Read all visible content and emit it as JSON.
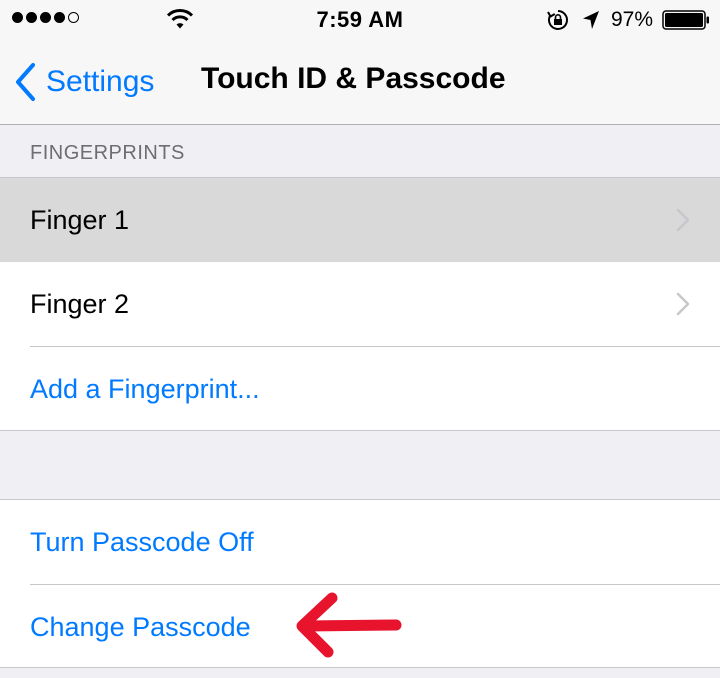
{
  "status_bar": {
    "time": "7:59 AM",
    "battery_percent": "97%",
    "signal_bars_filled": 4,
    "signal_bars_total": 5,
    "icons": [
      "wifi-icon",
      "rotation-lock-icon",
      "location-arrow-icon",
      "battery-icon"
    ]
  },
  "nav": {
    "back_label": "Settings",
    "title": "Touch ID & Passcode",
    "back_icon": "chevron-left-icon"
  },
  "fingerprints": {
    "header": "FINGERPRINTS",
    "items": [
      {
        "label": "Finger 1",
        "selected": true
      },
      {
        "label": "Finger 2",
        "selected": false
      }
    ],
    "add_label": "Add a Fingerprint..."
  },
  "passcode": {
    "turn_off_label": "Turn Passcode Off",
    "change_label": "Change Passcode"
  },
  "colors": {
    "accent": "#007aff",
    "annotation": "#e8132c",
    "background": "#efeff4",
    "selected_row": "#d9d9d9"
  }
}
